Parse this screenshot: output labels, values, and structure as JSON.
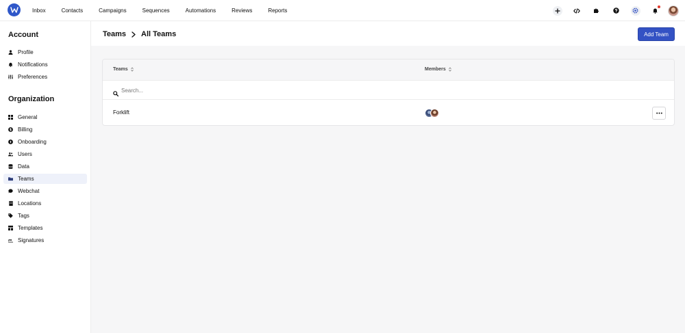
{
  "nav": {
    "links": [
      "Inbox",
      "Contacts",
      "Campaigns",
      "Sequences",
      "Automations",
      "Reviews",
      "Reports"
    ],
    "icons": [
      "plus-icon",
      "code-icon",
      "puzzle-icon",
      "help-icon",
      "settings-icon",
      "bell-icon"
    ],
    "brand_color": "#2f57c9",
    "notification_dot_color": "#e23b2e"
  },
  "sidebar": {
    "account_heading": "Account",
    "account_items": [
      {
        "label": "Profile",
        "icon": "user-icon"
      },
      {
        "label": "Notifications",
        "icon": "bell-icon"
      },
      {
        "label": "Preferences",
        "icon": "sliders-icon"
      }
    ],
    "organization_heading": "Organization",
    "organization_items": [
      {
        "label": "General",
        "icon": "grid-icon"
      },
      {
        "label": "Billing",
        "icon": "dollar-icon"
      },
      {
        "label": "Onboarding",
        "icon": "compass-icon"
      },
      {
        "label": "Users",
        "icon": "users-icon"
      },
      {
        "label": "Data",
        "icon": "database-icon"
      },
      {
        "label": "Teams",
        "icon": "folder-icon",
        "active": true
      },
      {
        "label": "Webchat",
        "icon": "chat-icon"
      },
      {
        "label": "Locations",
        "icon": "building-icon"
      },
      {
        "label": "Tags",
        "icon": "tag-icon"
      },
      {
        "label": "Templates",
        "icon": "template-icon"
      },
      {
        "label": "Signatures",
        "icon": "signature-icon"
      }
    ]
  },
  "header": {
    "breadcrumb_parent": "Teams",
    "breadcrumb_current": "All Teams",
    "add_button_label": "Add Team",
    "accent_color": "#3452c4"
  },
  "table": {
    "columns": [
      "Teams",
      "Members"
    ],
    "search_placeholder": "Search...",
    "rows": [
      {
        "name": "Forklift",
        "member_avatars": 2
      }
    ]
  }
}
